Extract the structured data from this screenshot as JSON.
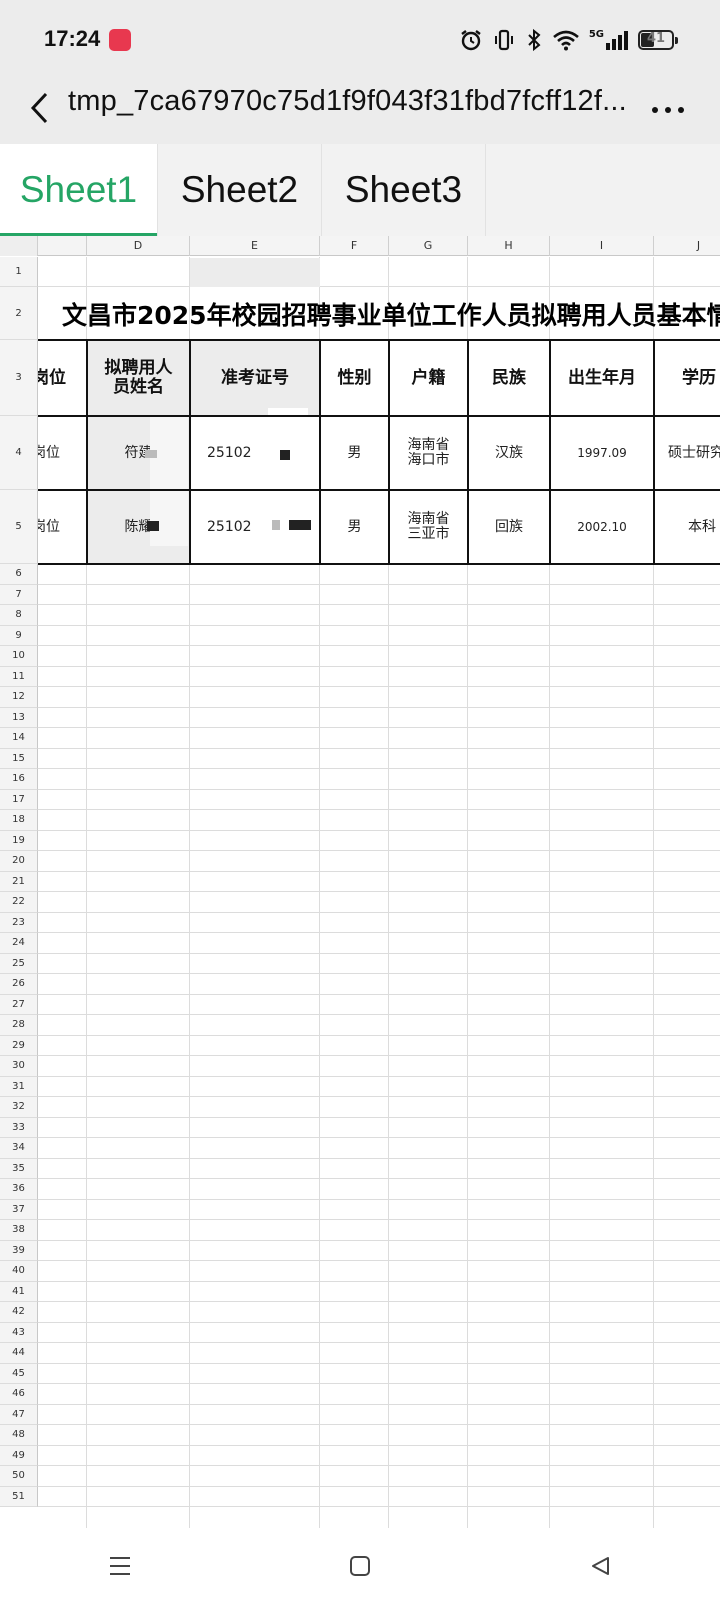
{
  "status_bar": {
    "time": "17:24",
    "network": "5G",
    "battery": "41",
    "icons": [
      "alarm-icon",
      "vibrate-icon",
      "bluetooth-icon",
      "wifi-icon",
      "signal-icon",
      "battery-icon"
    ]
  },
  "header": {
    "title": "tmp_7ca67970c75d1f9f043f31fbd7fcff12f...",
    "back_icon": "chevron-left-icon",
    "more_icon": "more-dots-icon"
  },
  "sheet_tabs": [
    {
      "label": "Sheet1",
      "active": true
    },
    {
      "label": "Sheet2",
      "active": false
    },
    {
      "label": "Sheet3",
      "active": false
    }
  ],
  "columns": [
    "D",
    "E",
    "F",
    "G",
    "H",
    "I",
    "J"
  ],
  "rows": [
    "1",
    "2",
    "3",
    "4",
    "5",
    "6",
    "7",
    "8",
    "9",
    "10",
    "11",
    "12",
    "13",
    "14",
    "15",
    "16",
    "17",
    "18",
    "19",
    "20",
    "21",
    "22",
    "23",
    "24",
    "25",
    "26",
    "27",
    "28",
    "29",
    "30",
    "31",
    "32",
    "33",
    "34",
    "35",
    "36",
    "37",
    "38",
    "39",
    "40",
    "41",
    "42",
    "43",
    "44",
    "45",
    "46",
    "47",
    "48",
    "49",
    "50",
    "51"
  ],
  "table": {
    "title": "文昌市2025年校园招聘事业单位工作人员拟聘用人员基本情",
    "headers": [
      "岗位",
      "拟聘用人员姓名",
      "准考证号",
      "性别",
      "户籍",
      "民族",
      "出生年月",
      "学历"
    ],
    "records": [
      {
        "position": "岗位",
        "name": "符建",
        "id": "25102",
        "gender": "男",
        "hukou": "海南省海口市",
        "ethnicity": "汉族",
        "birth": "1997.09",
        "education": "硕士研究"
      },
      {
        "position": "岗位",
        "name": "陈耀",
        "id": "25102",
        "gender": "男",
        "hukou": "海南省三亚市",
        "ethnicity": "回族",
        "birth": "2002.10",
        "education": "本科"
      }
    ]
  },
  "nav_bar": [
    "menu-icon",
    "home-square-icon",
    "back-triangle-icon"
  ],
  "colors": {
    "accent": "#25a565",
    "toolbar_bg": "#ececec"
  }
}
